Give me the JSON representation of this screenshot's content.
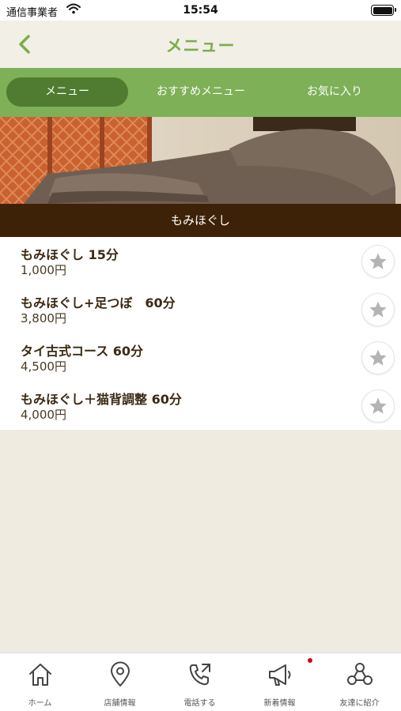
{
  "status_bar": {
    "carrier": "通信事業者",
    "time": "15:54"
  },
  "header": {
    "title": "メニュー"
  },
  "tabs": [
    {
      "label": "メニュー",
      "active": true
    },
    {
      "label": "おすすめメニュー",
      "active": false
    },
    {
      "label": "お気に入り",
      "active": false
    }
  ],
  "category": {
    "title": "もみほぐし"
  },
  "menu_items": [
    {
      "name": "もみほぐし 15分",
      "price": "1,000円"
    },
    {
      "name": "もみほぐし+足つぼ　60分",
      "price": "3,800円"
    },
    {
      "name": "タイ古式コース 60分",
      "price": "4,500円"
    },
    {
      "name": "もみほぐし＋猫背調整 60分",
      "price": "4,000円"
    }
  ],
  "bottom_nav": [
    {
      "label": "ホーム",
      "icon": "home-icon"
    },
    {
      "label": "店舗情報",
      "icon": "map-pin-icon"
    },
    {
      "label": "電話する",
      "icon": "phone-icon"
    },
    {
      "label": "新着情報",
      "icon": "megaphone-icon",
      "badge": true
    },
    {
      "label": "友達に紹介",
      "icon": "share-friends-icon"
    }
  ],
  "colors": {
    "accent": "#7eb057",
    "accent_dark": "#4f7c30",
    "category_bar": "#3d2208",
    "background": "#efebe1"
  }
}
